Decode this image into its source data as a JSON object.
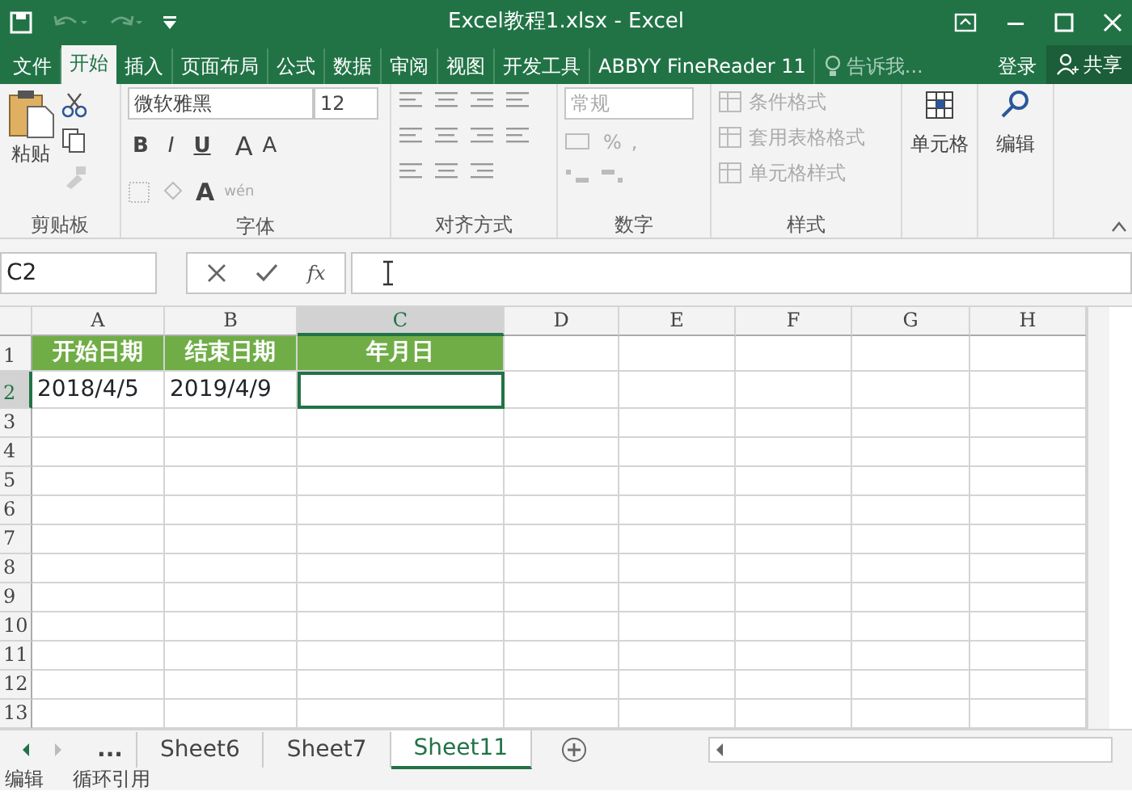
{
  "window": {
    "title": "Excel教程1.xlsx - Excel"
  },
  "tabs": [
    {
      "label": "文件",
      "selected": false
    },
    {
      "label": "开始",
      "selected": true
    },
    {
      "label": "插入",
      "selected": false
    },
    {
      "label": "页面布局",
      "selected": false
    },
    {
      "label": "公式",
      "selected": false
    },
    {
      "label": "数据",
      "selected": false
    },
    {
      "label": "审阅",
      "selected": false
    },
    {
      "label": "视图",
      "selected": false
    },
    {
      "label": "开发工具",
      "selected": false
    },
    {
      "label": "ABBYY FineReader 11",
      "selected": false
    }
  ],
  "tell_me": "告诉我...",
  "sign_in": "登录",
  "share": "共享",
  "ribbon": {
    "clipboard": {
      "paste": "粘贴",
      "label": "剪贴板"
    },
    "font": {
      "name": "微软雅黑",
      "size": "12",
      "style_buttons": [
        "B",
        "I",
        "U"
      ],
      "grow": "A",
      "shrink": "A",
      "font_color": "A",
      "phonetic": "wén",
      "label": "字体"
    },
    "alignment": {
      "label": "对齐方式"
    },
    "number": {
      "format": "常规",
      "percent": "%",
      "comma": ",",
      "label": "数字"
    },
    "styles": {
      "items": [
        "条件格式",
        "套用表格格式",
        "单元格样式"
      ],
      "label": "样式"
    },
    "cells": {
      "label": "单元格"
    },
    "editing": {
      "label": "编辑"
    }
  },
  "formula_bar": {
    "name_box": "C2",
    "fx": "fx"
  },
  "columns": [
    {
      "label": "A",
      "selected": false
    },
    {
      "label": "B",
      "selected": false
    },
    {
      "label": "C",
      "selected": true
    },
    {
      "label": "D",
      "selected": false
    },
    {
      "label": "E",
      "selected": false
    },
    {
      "label": "F",
      "selected": false
    },
    {
      "label": "G",
      "selected": false
    },
    {
      "label": "H",
      "selected": false
    }
  ],
  "rows": [
    {
      "label": "1",
      "kind": "header",
      "selected": false,
      "cells": [
        "开始日期",
        "结束日期",
        "年月日"
      ]
    },
    {
      "label": "2",
      "kind": "data",
      "selected": true,
      "cells": [
        "2018/4/5",
        "2019/4/9"
      ]
    },
    {
      "label": "3",
      "selected": false
    },
    {
      "label": "4",
      "selected": false
    },
    {
      "label": "5",
      "selected": false
    },
    {
      "label": "6",
      "selected": false
    },
    {
      "label": "7",
      "selected": false
    },
    {
      "label": "8",
      "selected": false
    },
    {
      "label": "9",
      "selected": false
    },
    {
      "label": "10",
      "selected": false
    },
    {
      "label": "11",
      "selected": false
    },
    {
      "label": "12",
      "selected": false
    },
    {
      "label": "13",
      "selected": false
    }
  ],
  "sheet_overflow": "...",
  "sheets": [
    {
      "label": "Sheet6",
      "selected": false
    },
    {
      "label": "Sheet7",
      "selected": false
    },
    {
      "label": "Sheet11",
      "selected": true
    }
  ],
  "status_bar": [
    "编辑",
    "循环引用"
  ]
}
